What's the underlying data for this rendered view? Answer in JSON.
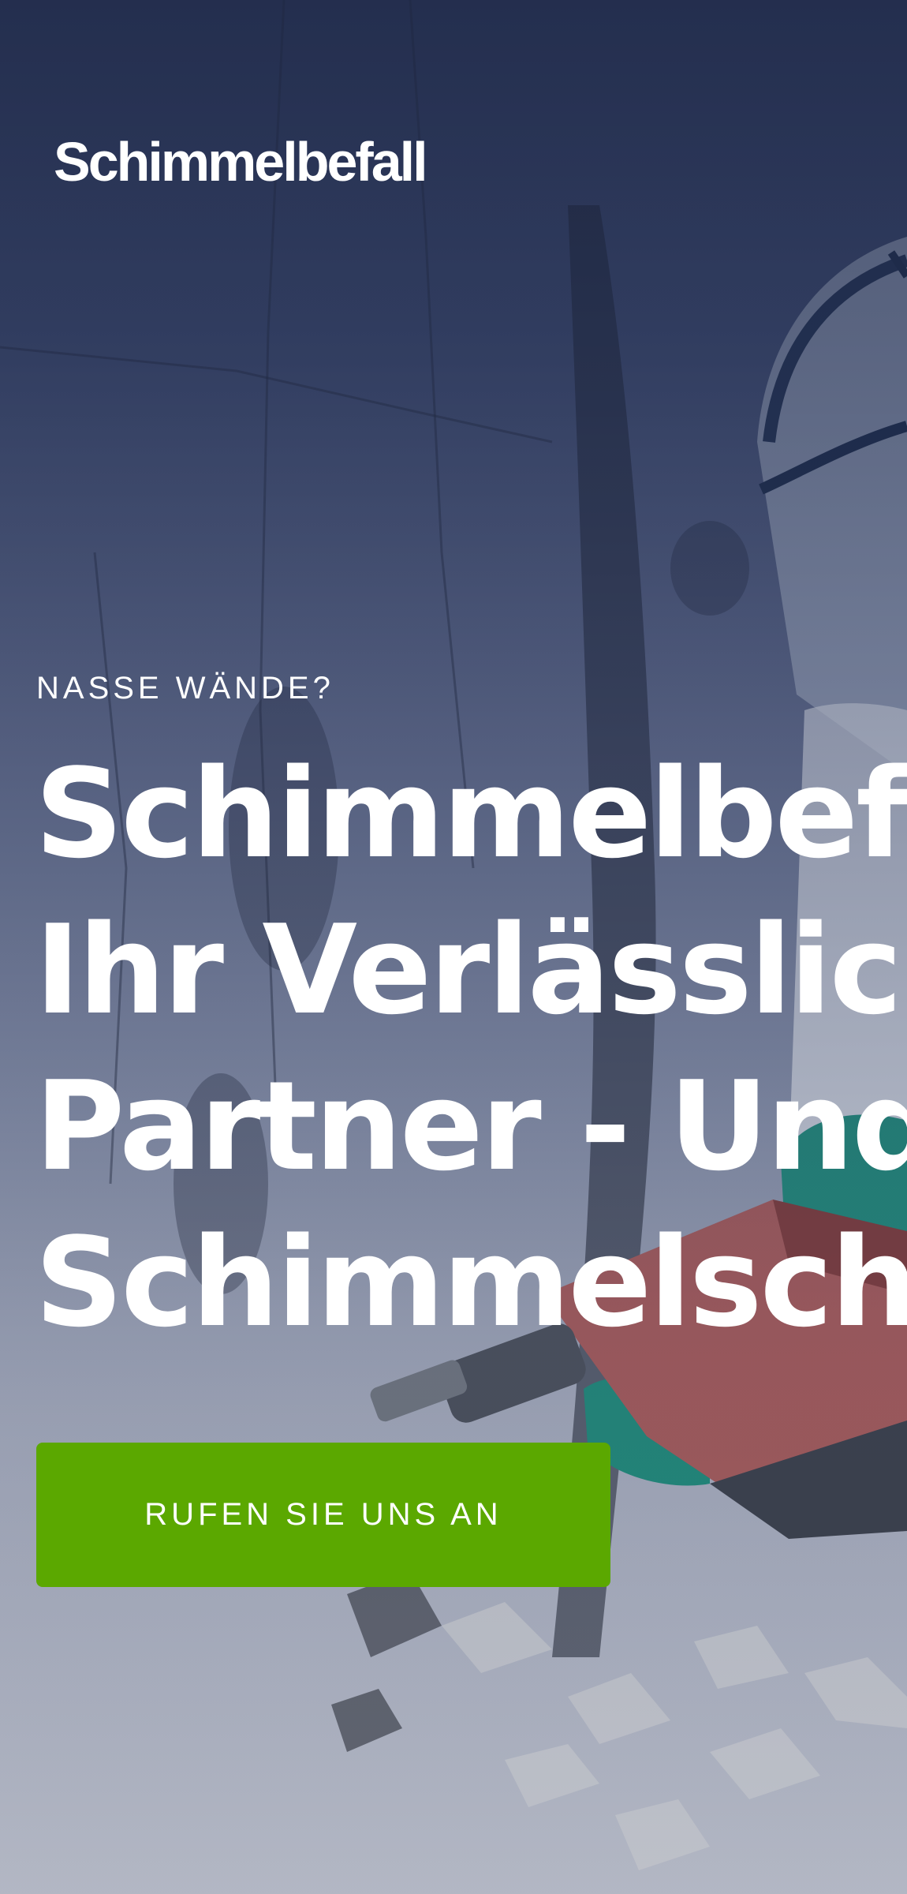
{
  "brand": {
    "logo_text": "Schimmelbefall"
  },
  "hero": {
    "eyebrow": "NASSE WÄNDE?",
    "headline_lines": [
      "Schimmelbefall:",
      "Ihr Verlässlicher",
      "Partner - Und",
      "Schimmelschutz"
    ],
    "cta_label": "RUFEN SIE UNS AN",
    "cta_color": "#5ba800",
    "background_image": "worker-removing-mold-from-wall-photo"
  }
}
